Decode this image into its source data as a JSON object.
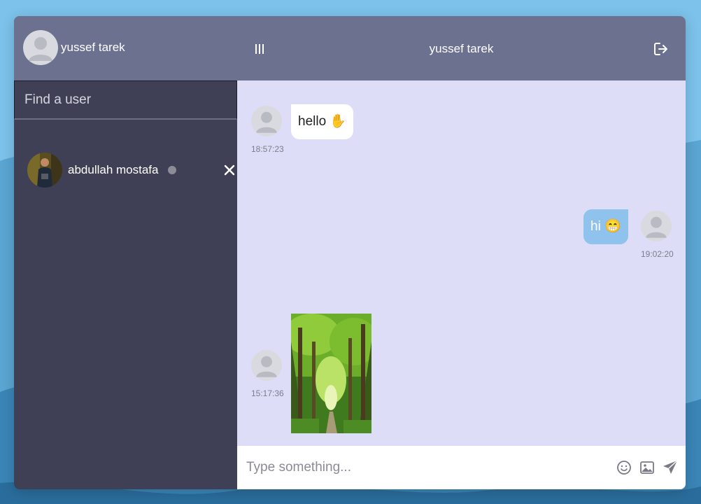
{
  "user": {
    "name": "yussef tarek"
  },
  "search": {
    "placeholder": "Find a user"
  },
  "contacts": [
    {
      "name": "abdullah mostafa",
      "status": "offline"
    }
  ],
  "chat": {
    "title": "yussef tarek",
    "messages": [
      {
        "direction": "incoming",
        "text": "hello ✋",
        "time": "18:57:23"
      },
      {
        "direction": "outgoing",
        "text": "hi 😁",
        "time": "19:02:20"
      },
      {
        "direction": "incoming",
        "type": "image",
        "image": "green-forest-path-photo",
        "time": "15:17:36"
      }
    ]
  },
  "composer": {
    "placeholder": "Type something..."
  },
  "icons": {
    "menu": "menu-icon",
    "logout": "logout-icon",
    "close": "close-icon",
    "emoji": "emoji-icon",
    "image": "image-icon",
    "send": "send-icon"
  },
  "colors": {
    "header": "#6c7190",
    "sidebar": "#3f4056",
    "chat_bg": "#ddddf7",
    "outgoing_bubble": "#8fc2ec",
    "incoming_bubble": "#ffffff"
  }
}
